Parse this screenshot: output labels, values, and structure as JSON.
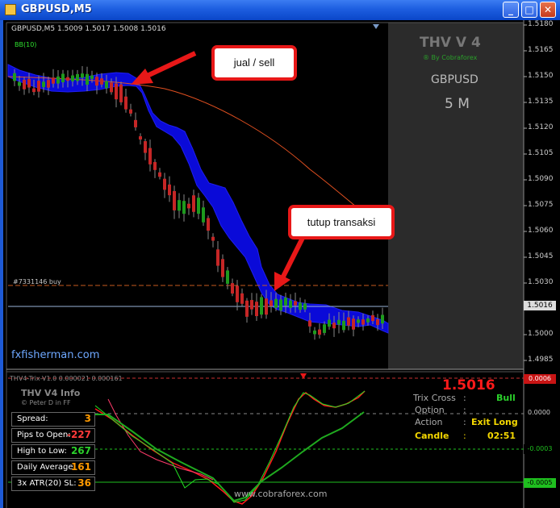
{
  "window": {
    "title": "GBPUSD,M5",
    "buttons": [
      "_",
      "□",
      "✕"
    ]
  },
  "chart": {
    "header": "GBPUSD,M5  1.5009 1.5017 1.5008 1.5016",
    "indicator_label": "BB(10)",
    "order_line_label": "#7331146 buy",
    "watermark": "fxfisherman.com",
    "current_price": "1.5016",
    "price_ticks": [
      "1.5180",
      "1.5165",
      "1.5150",
      "1.5135",
      "1.5120",
      "1.5105",
      "1.5090",
      "1.5075",
      "1.5060",
      "1.5045",
      "1.5030",
      "1.5016",
      "1.5000",
      "1.4985"
    ]
  },
  "panel": {
    "title": "THV V 4",
    "byline": "® By Cobraforex",
    "symbol": "GBPUSD",
    "timeframe": "5 M"
  },
  "callouts": {
    "sell": "jual / sell",
    "close": "tutup transaksi"
  },
  "sub": {
    "header": "THV4-Trix-V1.0 0.000021 0.000161",
    "info_title": "THV  V4  Info",
    "info_sub": "© Peter D in FF",
    "rows": [
      {
        "label": "Spread:",
        "value": "3",
        "color": "#ff9a00"
      },
      {
        "label": "Pips to Open:",
        "value": "-227",
        "color": "#ff3a3a"
      },
      {
        "label": "High to Low:",
        "value": "267",
        "color": "#2bd02b"
      },
      {
        "label": "Daily Average:",
        "value": "161",
        "color": "#ff9a00"
      },
      {
        "label": "3x ATR(20) SL:",
        "value": "36",
        "color": "#ff9a00"
      }
    ],
    "price_big": "1.5016",
    "trix_cross_label": "Trix Cross",
    "trix_cross_value": "Bull",
    "option_label": "Option",
    "action_label": "Action",
    "action_value": "Exit Long",
    "candle_label": "Candle",
    "candle_value": "02:51",
    "site": "www.cobraforex.com",
    "scale": [
      "0.0006",
      "0.0000",
      "-0.0003",
      "-0.0005"
    ]
  }
}
